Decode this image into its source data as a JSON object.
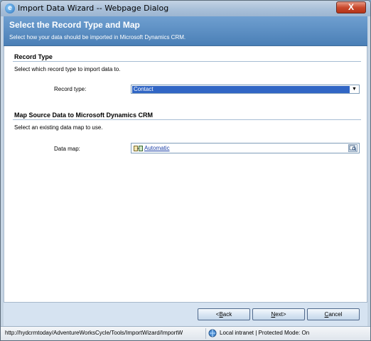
{
  "window": {
    "title": "Import Data Wizard -- Webpage Dialog",
    "close_glyph": "X"
  },
  "header": {
    "title": "Select the Record Type and Map",
    "subtitle": "Select how your data should be imported in Microsoft Dynamics CRM."
  },
  "record_section": {
    "title": "Record Type",
    "description": "Select which record type to import data to.",
    "field_label": "Record type:",
    "selected_value": "Contact",
    "dropdown_glyph": "▼"
  },
  "map_section": {
    "title": "Map Source Data to Microsoft Dynamics CRM",
    "description": "Select an existing data map to use.",
    "field_label": "Data map:",
    "value": "Automatic"
  },
  "buttons": {
    "back": {
      "prefix": "<",
      "hotkey": "B",
      "rest": "ack"
    },
    "next": {
      "prefix": "",
      "hotkey": "N",
      "rest": "ext>"
    },
    "cancel": {
      "prefix": "",
      "hotkey": "C",
      "rest": "ancel"
    }
  },
  "statusbar": {
    "url": "http://hydcrmtoday/AdventureWorksCycle/Tools/ImportWizard/ImportW",
    "zone": "Local intranet | Protected Mode: On"
  },
  "icons": {
    "window_icon": "ie-page-icon",
    "map_icon": "data-map-icon",
    "lookup_icon": "lookup-icon",
    "zone_icon": "local-intranet-icon"
  },
  "colors": {
    "header_band": "#4a7fb6",
    "selection": "#3166c5",
    "link": "#1b3fa6"
  }
}
